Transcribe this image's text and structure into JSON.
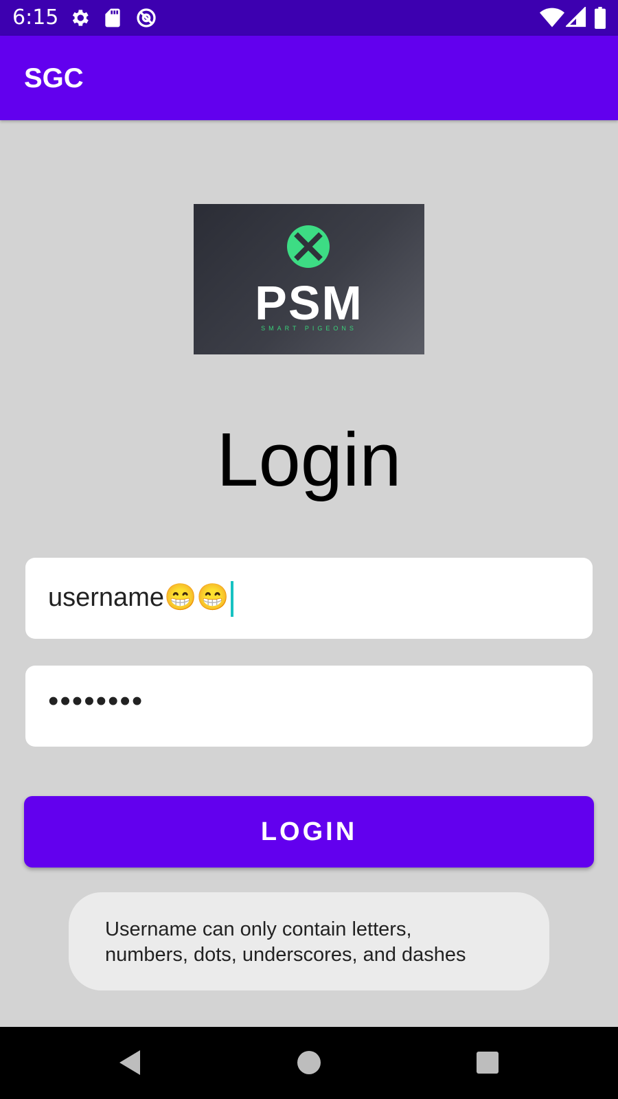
{
  "status_bar": {
    "time": "6:15",
    "left_icons": [
      "settings-icon",
      "sd-card-icon",
      "at-sign-icon"
    ],
    "right_icons": [
      "wifi-icon",
      "signal-icon",
      "battery-icon"
    ]
  },
  "app_bar": {
    "title": "SGC"
  },
  "logo": {
    "text": "PSM",
    "subtitle": "SMART PIGEONS",
    "accent_color": "#3ddc84"
  },
  "page_title": "Login",
  "form": {
    "username_value": "username😁😁",
    "password_value": "••••••••",
    "login_label": "LOGIN"
  },
  "toast": {
    "line1": "Username can only contain letters,",
    "line2": "numbers, dots, underscores, and dashes"
  },
  "nav_bar": {
    "icons": [
      "back-icon",
      "home-icon",
      "recents-icon"
    ]
  },
  "colors": {
    "primary": "#6200ee",
    "status_bar": "#3d00b0",
    "background": "#d3d3d3",
    "cursor": "#17c2c2"
  }
}
